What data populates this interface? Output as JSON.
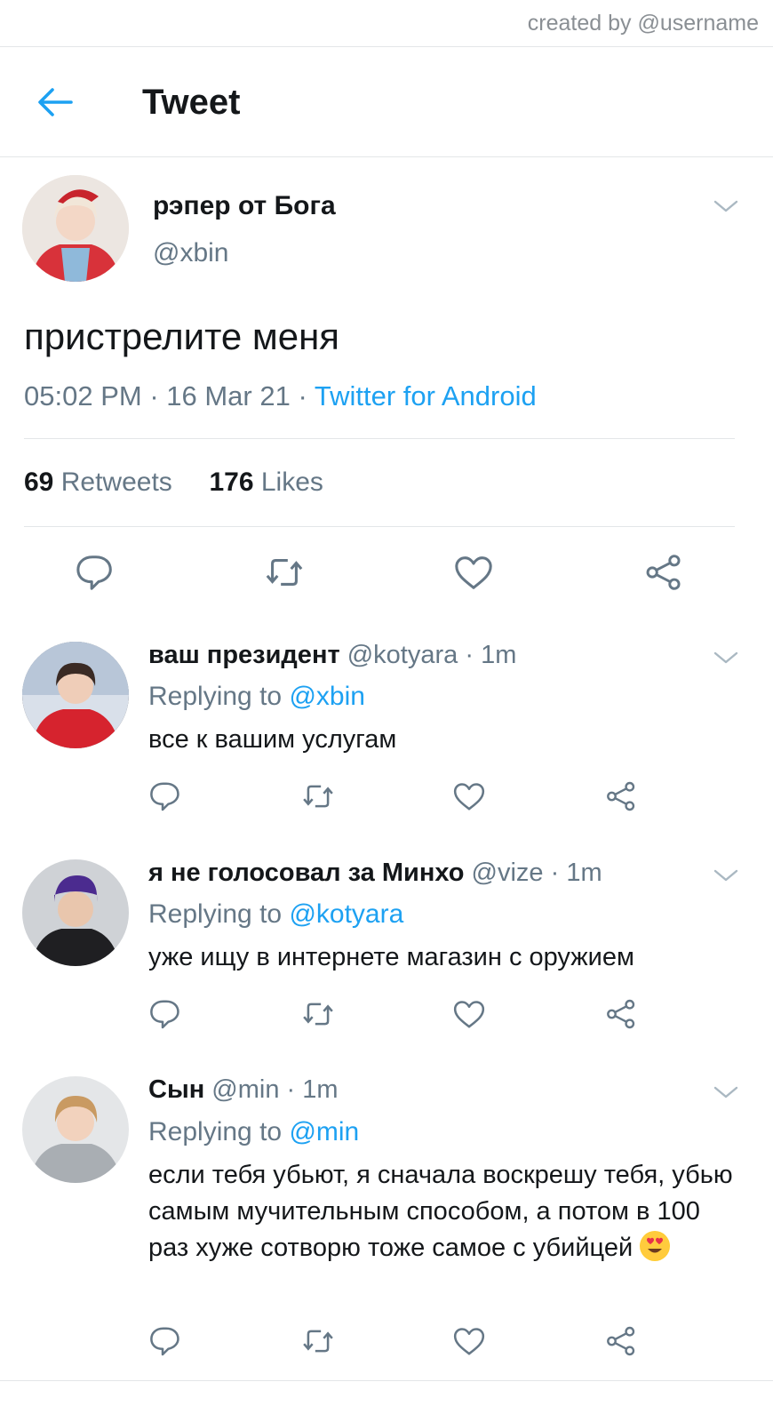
{
  "credit": "created by @username",
  "header": {
    "title": "Tweet"
  },
  "tweet": {
    "name": "рэпер от Бога",
    "handle": "@xbin",
    "text": "пристрелите меня",
    "time": "05:02 PM",
    "date": "16 Mar 21",
    "source": "Twitter for Android",
    "retweets_count": "69",
    "retweets_label": "Retweets",
    "likes_count": "176",
    "likes_label": "Likes"
  },
  "replying_prefix": "Replying to",
  "replies": [
    {
      "name": "ваш президент",
      "handle": "@kotyara",
      "time": "1m",
      "reply_to": "@xbin",
      "text": "все к вашим услугам"
    },
    {
      "name": "я не голосовал за Минхо",
      "handle": "@vize",
      "time": "1m",
      "reply_to": "@kotyara",
      "text": "уже ищу в интернете магазин с оружием"
    },
    {
      "name": "Сын",
      "handle": "@min",
      "time": "1m",
      "reply_to": "@min",
      "text": "если тебя убьют, я сначала воскрешу тебя, убью самым мучительным способом, а потом в 100 раз хуже сотворю тоже самое с убийцей"
    }
  ],
  "colors": {
    "accent": "#1da1f2",
    "muted": "#657786",
    "text": "#14171a",
    "divider": "#e3e6e8"
  },
  "icons": [
    "back-arrow-icon",
    "chevron-down-icon",
    "reply-icon",
    "retweet-icon",
    "like-icon",
    "share-icon",
    "heart-eyes-emoji"
  ]
}
